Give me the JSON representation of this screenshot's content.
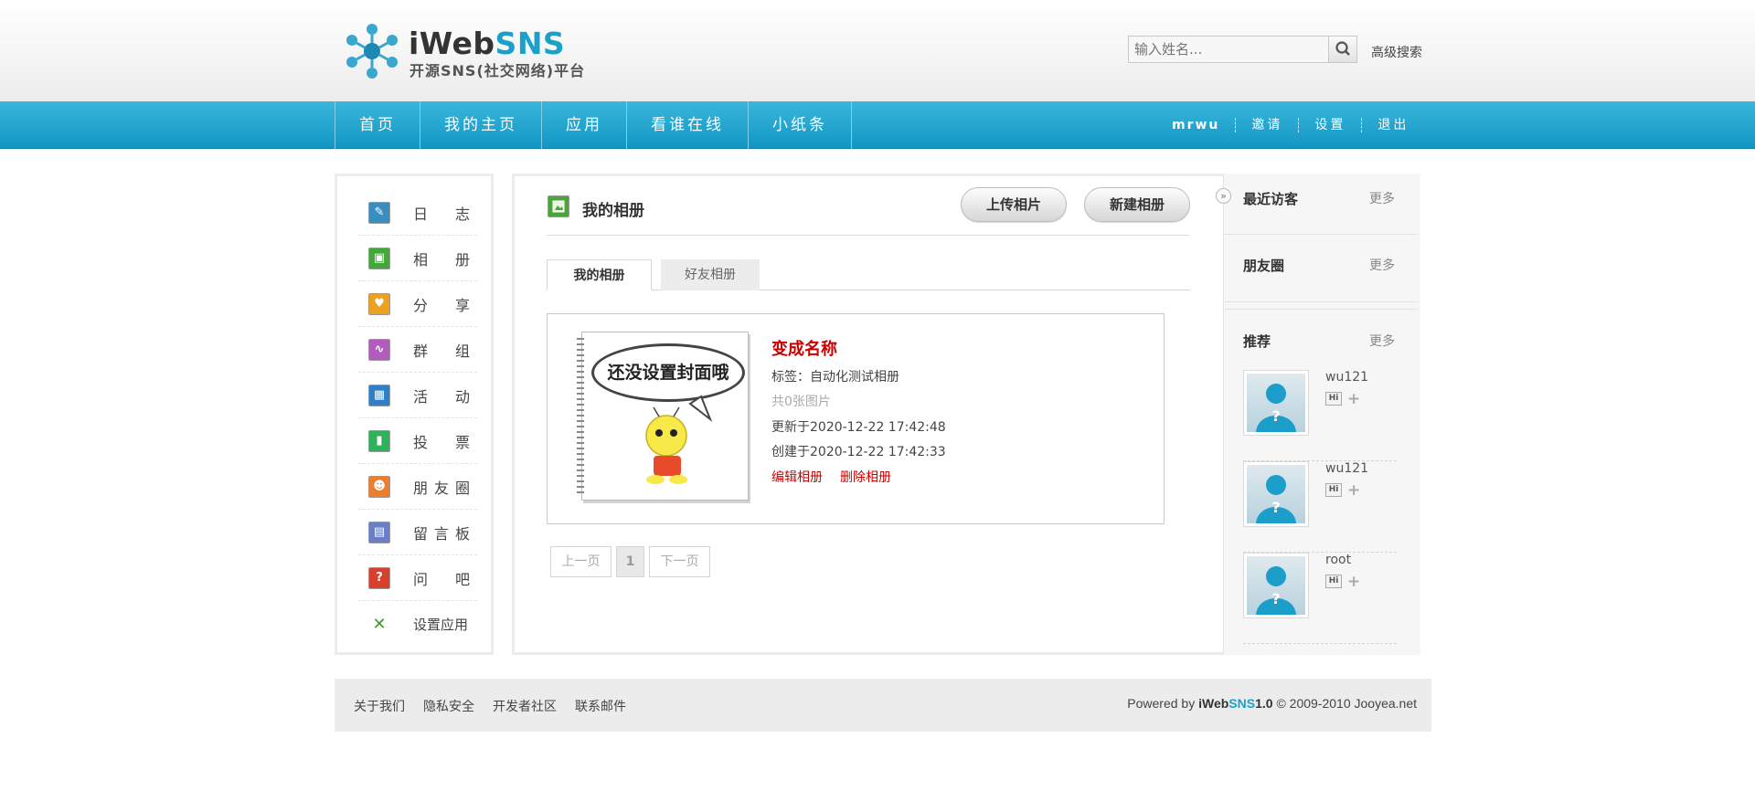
{
  "header": {
    "logo_text_a": "iWeb",
    "logo_text_b": "SNS",
    "logo_sub": "开源SNS(社交网络)平台",
    "search_placeholder": "输入姓名...",
    "advanced_search": "高级搜索"
  },
  "nav": {
    "items": [
      {
        "label": "首页"
      },
      {
        "label": "我的主页"
      },
      {
        "label": "应用"
      },
      {
        "label": "看谁在线"
      },
      {
        "label": "小纸条"
      }
    ],
    "user": "mrwu",
    "invite": "邀请",
    "settings": "设置",
    "logout": "退出"
  },
  "sidebar": {
    "items": [
      {
        "label": "日志",
        "icon": "pen-icon",
        "color": "#3a8dbf"
      },
      {
        "label": "相册",
        "icon": "photo-icon",
        "color": "#43a83a"
      },
      {
        "label": "分享",
        "icon": "heart-icon",
        "color": "#f0a020"
      },
      {
        "label": "群组",
        "icon": "group-icon",
        "color": "#b25dbd"
      },
      {
        "label": "活动",
        "icon": "calendar-icon",
        "color": "#2f7fc8"
      },
      {
        "label": "投票",
        "icon": "bar-chart-icon",
        "color": "#2fb25a"
      },
      {
        "label": "朋友圈",
        "icon": "friends-icon",
        "color": "#ec7f2d"
      },
      {
        "label": "留言板",
        "icon": "board-icon",
        "color": "#6a7fc8"
      },
      {
        "label": "问吧",
        "icon": "question-icon",
        "color": "#d8402e"
      }
    ],
    "settings_app": "设置应用"
  },
  "main": {
    "title": "我的相册",
    "upload_button": "上传相片",
    "new_album_button": "新建相册",
    "tabs": [
      {
        "label": "我的相册",
        "active": true
      },
      {
        "label": "好友相册",
        "active": false
      }
    ],
    "album": {
      "cover_text": "还没设置封面哦",
      "name": "变成名称",
      "tag_line": "标签：自动化测试相册",
      "count_line": "共0张图片",
      "updated_line": "更新于2020-12-22 17:42:48",
      "created_line": "创建于2020-12-22 17:42:33",
      "edit_link": "编辑相册",
      "delete_link": "删除相册"
    },
    "pagination": {
      "prev": "上一页",
      "current": "1",
      "next": "下一页"
    }
  },
  "right": {
    "toggle": "»",
    "recent_visitors": "最近访客",
    "friend_circle": "朋友圈",
    "recommend": "推荐",
    "more": "更多",
    "hi": "Hi",
    "plus": "+",
    "recommended_users": [
      {
        "name": "wu121"
      },
      {
        "name": "wu121"
      },
      {
        "name": "root"
      }
    ]
  },
  "footer": {
    "links": [
      "关于我们",
      "隐私安全",
      "开发者社区",
      "联系邮件"
    ],
    "powered_by": "Powered by ",
    "brand_a": "iWeb",
    "brand_b": "SNS",
    "version": "1.0",
    "copyright": " © 2009-2010 Jooyea.net"
  }
}
